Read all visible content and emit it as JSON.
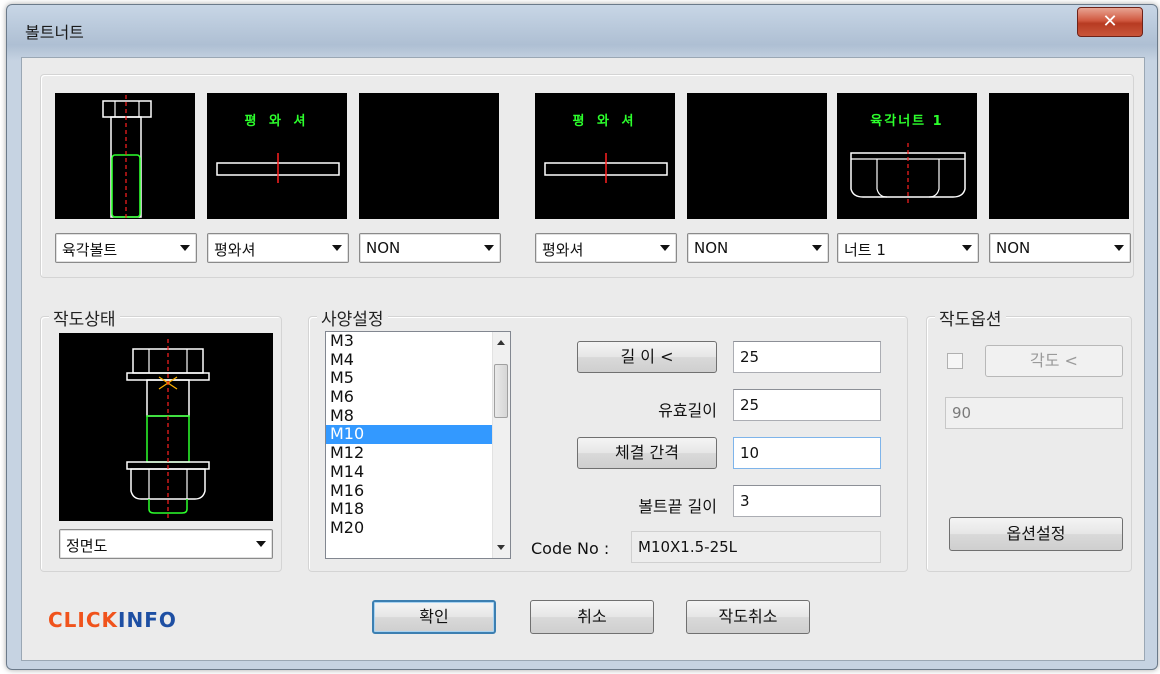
{
  "window": {
    "title": "볼트너트",
    "close_label": "✕"
  },
  "assembly": {
    "slots": [
      {
        "preview_text": "",
        "selected": "육각볼트"
      },
      {
        "preview_text": "평 와 셔",
        "selected": "평와셔"
      },
      {
        "preview_text": "",
        "selected": "NON"
      },
      {
        "preview_text": "평 와 셔",
        "selected": "평와셔"
      },
      {
        "preview_text": "",
        "selected": "NON"
      },
      {
        "preview_text": "육각너트 1",
        "selected": "너트 1"
      },
      {
        "preview_text": "",
        "selected": "NON"
      }
    ]
  },
  "drawing_state": {
    "label": "작도상태",
    "view_selected": "정면도"
  },
  "spec": {
    "label": "사양설정",
    "sizes": [
      "M3",
      "M4",
      "M5",
      "M6",
      "M8",
      "M10",
      "M12",
      "M14",
      "M16",
      "M18",
      "M20"
    ],
    "selected_size": "M10",
    "length_button": "길 이 <",
    "length_value": "25",
    "effective_length_label": "유효길이",
    "effective_length_value": "25",
    "clamp_button": "체결 간격",
    "clamp_value": "10",
    "tail_length_label": "볼트끝 길이",
    "tail_length_value": "3",
    "code_label": "Code No :",
    "code_value": "M10X1.5-25L"
  },
  "options": {
    "label": "작도옵션",
    "angle_button": "각도 <",
    "angle_value": "90",
    "settings_button": "옵션설정"
  },
  "footer": {
    "logo_part1": "CLICK",
    "logo_part2": "INFO",
    "ok": "확인",
    "cancel": "취소",
    "cancel_drawing": "작도취소"
  },
  "colors": {
    "accent_green": "#2cff2c",
    "center_line_red": "#ff2020",
    "selection_blue": "#3399ff",
    "logo_orange": "#f0531c",
    "logo_blue": "#1e4fa3"
  }
}
